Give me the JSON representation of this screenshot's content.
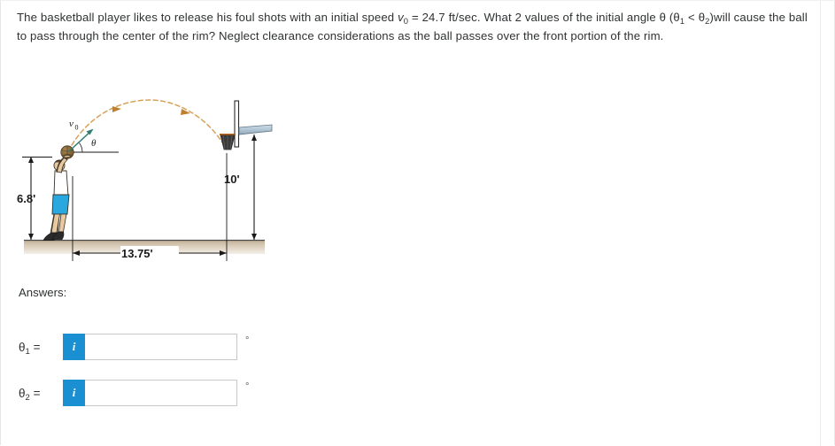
{
  "problem": {
    "part1": "The basketball player likes to release his foul shots with an initial speed ",
    "v_symbol": "v",
    "v_sub": "0",
    "part2": " = 24.7 ft/sec. What 2 values of the initial angle ",
    "theta_symbol": "θ",
    "part3": " (",
    "theta1_symbol": "θ",
    "theta1_sub": "1",
    "part4": " < ",
    "theta2_symbol": "θ",
    "theta2_sub": "2",
    "part5": ")will cause the ball to pass through the center of the rim? Neglect clearance considerations as the ball passes over the front portion of the rim."
  },
  "figure": {
    "release_height_label": "6.8'",
    "rim_height_label": "10'",
    "horizontal_distance_label": "13.75'",
    "velocity_label": "v",
    "velocity_sub": "0",
    "angle_label": "θ",
    "colors": {
      "trajectory": "#d8a15a",
      "velocity_arrow": "#2e7d6e",
      "shorts": "#29a8e0",
      "skin": "#e8c9a0",
      "ball": "#8a6b3f",
      "ground": "#c9b79e",
      "backboard_arm": "#b9ccd8",
      "dimension_line": "#1a1a1a",
      "net": "#3a3a3a"
    }
  },
  "answers": {
    "heading": "Answers:",
    "rows": [
      {
        "label": "θ",
        "label_sub": "1",
        "label_eq": " =",
        "info_glyph": "i",
        "value": "",
        "placeholder": "",
        "unit": "°"
      },
      {
        "label": "θ",
        "label_sub": "2",
        "label_eq": " =",
        "info_glyph": "i",
        "value": "",
        "placeholder": "",
        "unit": "°"
      }
    ]
  }
}
